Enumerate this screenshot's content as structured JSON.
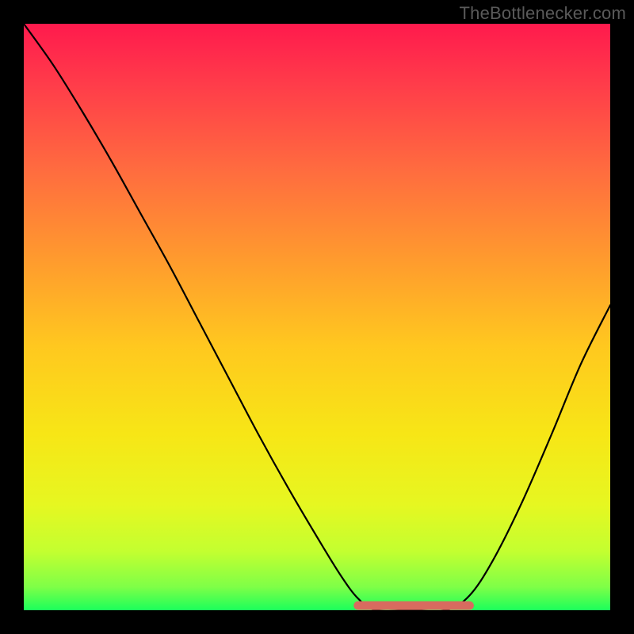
{
  "watermark": "TheBottlenecker.com",
  "chart_data": {
    "type": "line",
    "title": "",
    "xlabel": "",
    "ylabel": "",
    "xlim": [
      0,
      1
    ],
    "ylim": [
      0,
      1
    ],
    "curve": [
      {
        "x": 0.0,
        "y": 1.0
      },
      {
        "x": 0.05,
        "y": 0.93
      },
      {
        "x": 0.1,
        "y": 0.85
      },
      {
        "x": 0.15,
        "y": 0.765
      },
      {
        "x": 0.2,
        "y": 0.675
      },
      {
        "x": 0.25,
        "y": 0.585
      },
      {
        "x": 0.3,
        "y": 0.49
      },
      {
        "x": 0.35,
        "y": 0.395
      },
      {
        "x": 0.4,
        "y": 0.3
      },
      {
        "x": 0.45,
        "y": 0.21
      },
      {
        "x": 0.5,
        "y": 0.125
      },
      {
        "x": 0.54,
        "y": 0.06
      },
      {
        "x": 0.57,
        "y": 0.02
      },
      {
        "x": 0.6,
        "y": 0.0
      },
      {
        "x": 0.66,
        "y": 0.0
      },
      {
        "x": 0.72,
        "y": 0.0
      },
      {
        "x": 0.76,
        "y": 0.025
      },
      {
        "x": 0.8,
        "y": 0.085
      },
      {
        "x": 0.85,
        "y": 0.185
      },
      {
        "x": 0.9,
        "y": 0.3
      },
      {
        "x": 0.95,
        "y": 0.42
      },
      {
        "x": 1.0,
        "y": 0.52
      }
    ],
    "red_floor_segment": {
      "x_start": 0.57,
      "x_end": 0.76,
      "y": 0.008
    },
    "gradient_stops": [
      {
        "offset": 0.0,
        "color": "#ff1a4d"
      },
      {
        "offset": 0.1,
        "color": "#ff3b4a"
      },
      {
        "offset": 0.25,
        "color": "#ff6c3f"
      },
      {
        "offset": 0.4,
        "color": "#ff9a2e"
      },
      {
        "offset": 0.55,
        "color": "#ffc81f"
      },
      {
        "offset": 0.7,
        "color": "#f7e616"
      },
      {
        "offset": 0.82,
        "color": "#e6f721"
      },
      {
        "offset": 0.9,
        "color": "#c3ff30"
      },
      {
        "offset": 0.96,
        "color": "#7fff47"
      },
      {
        "offset": 1.0,
        "color": "#1bff5b"
      }
    ],
    "red_segment_color": "#d86b5f"
  }
}
